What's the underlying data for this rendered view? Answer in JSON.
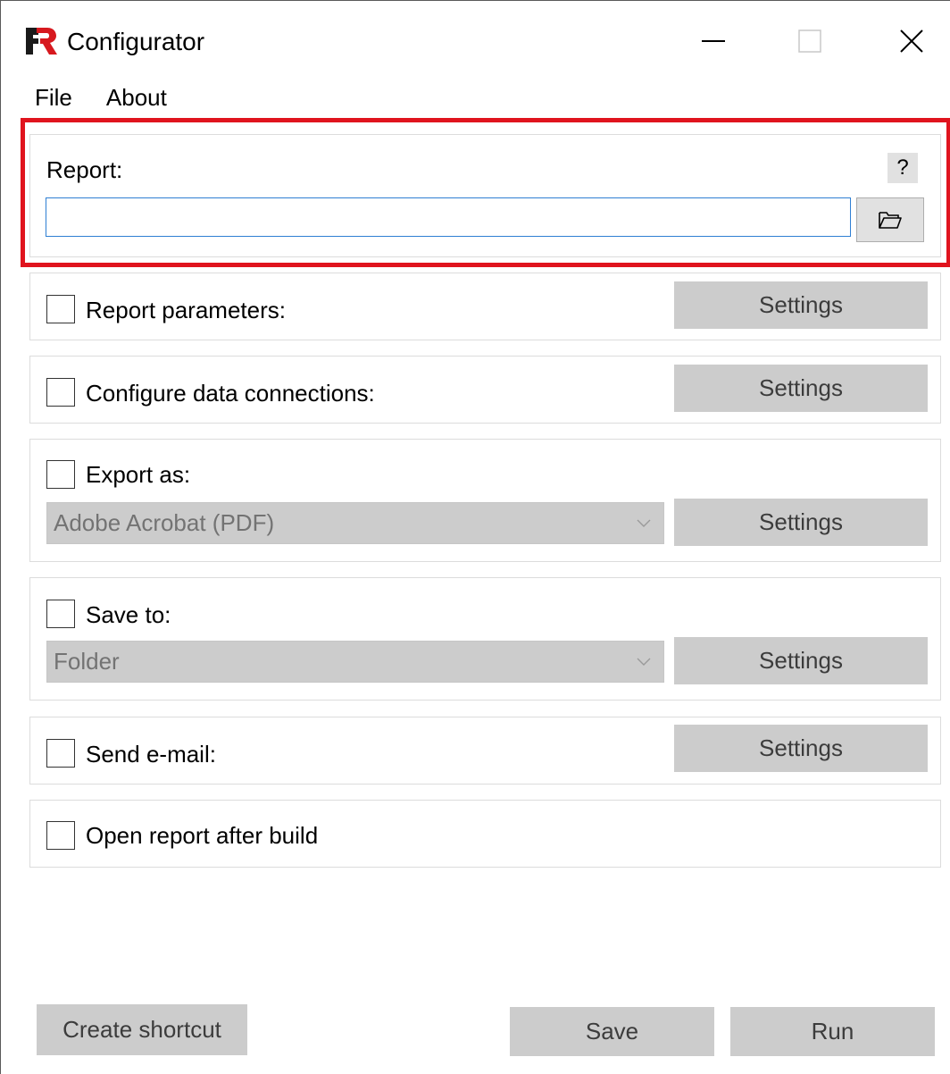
{
  "window": {
    "title": "Configurator",
    "accent_highlight": "#e0141e"
  },
  "menu": {
    "items": [
      "File",
      "About"
    ]
  },
  "report": {
    "label": "Report:",
    "help_label": "?",
    "path_value": "",
    "browse_icon": "folder-open-icon"
  },
  "options": {
    "report_parameters": {
      "label": "Report parameters:",
      "checked": false,
      "settings_label": "Settings"
    },
    "data_connections": {
      "label": "Configure data connections:",
      "checked": false,
      "settings_label": "Settings"
    },
    "export_as": {
      "label": "Export as:",
      "checked": false,
      "selected": "Adobe Acrobat (PDF)",
      "settings_label": "Settings"
    },
    "save_to": {
      "label": "Save to:",
      "checked": false,
      "selected": "Folder",
      "settings_label": "Settings"
    },
    "send_email": {
      "label": "Send e-mail:",
      "checked": false,
      "settings_label": "Settings"
    },
    "open_after_build": {
      "label": "Open report after build",
      "checked": false
    }
  },
  "footer": {
    "create_shortcut_label": "Create shortcut",
    "save_label": "Save",
    "run_label": "Run"
  }
}
